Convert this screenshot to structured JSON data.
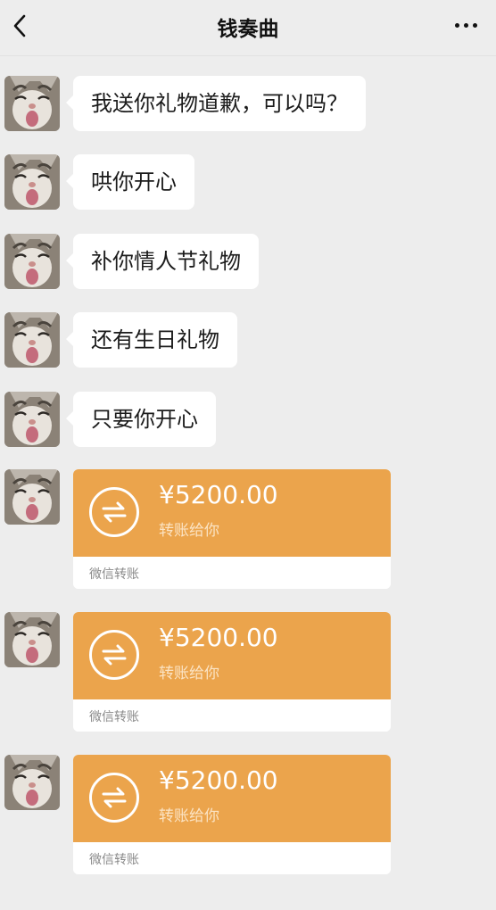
{
  "header": {
    "title": "钱奏曲",
    "back_icon": "chevron-left-icon",
    "more_icon": "more-dots-icon"
  },
  "messages": [
    {
      "type": "text",
      "text": "我送你礼物道歉，可以吗？"
    },
    {
      "type": "text",
      "text": "哄你开心"
    },
    {
      "type": "text",
      "text": "补你情人节礼物"
    },
    {
      "type": "text",
      "text": "还有生日礼物"
    },
    {
      "type": "text",
      "text": "只要你开心"
    },
    {
      "type": "transfer",
      "amount": "¥5200.00",
      "caption": "转账给你",
      "footer": "微信转账"
    },
    {
      "type": "transfer",
      "amount": "¥5200.00",
      "caption": "转账给你",
      "footer": "微信转账"
    },
    {
      "type": "transfer",
      "amount": "¥5200.00",
      "caption": "转账给你",
      "footer": "微信转账"
    }
  ],
  "colors": {
    "background": "#ededed",
    "bubble": "#ffffff",
    "transfer": "#eba44c"
  }
}
